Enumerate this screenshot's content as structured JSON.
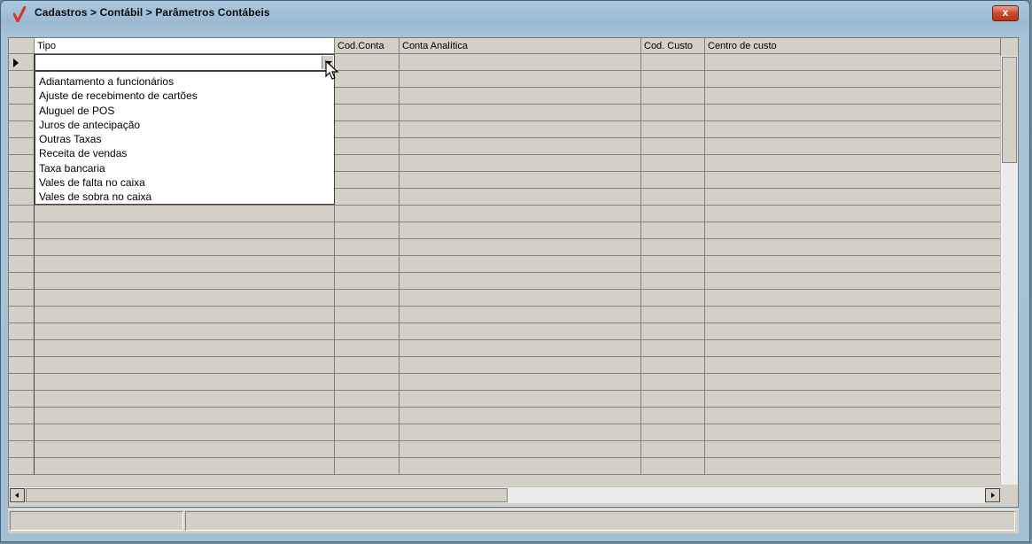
{
  "window": {
    "title": "Cadastros > Contábil > Parâmetros Contábeis",
    "close_label": "x"
  },
  "grid": {
    "columns": [
      {
        "key": "tipo",
        "label": "Tipo"
      },
      {
        "key": "cod_conta",
        "label": "Cod.Conta"
      },
      {
        "key": "conta_analitica",
        "label": "Conta Analítica"
      },
      {
        "key": "cod_custo",
        "label": "Cod. Custo"
      },
      {
        "key": "centro_custo",
        "label": "Centro de custo"
      }
    ],
    "current_value": ""
  },
  "dropdown": {
    "items": [
      "Adiantamento a funcionários",
      "Ajuste de recebimento de cartões",
      "Aluguel de POS",
      "Juros de antecipação",
      "Outras Taxas",
      "Receita de vendas",
      "Taxa bancaria",
      "Vales de falta no caixa",
      "Vales de sobra no caixa"
    ]
  },
  "statusbar": {
    "panel1": "",
    "panel2": ""
  },
  "colors": {
    "titlebar": "#a9c6dc",
    "client_bg": "#d4d0c8",
    "close_button": "#c7492e",
    "app_icon": "#e0301e"
  }
}
